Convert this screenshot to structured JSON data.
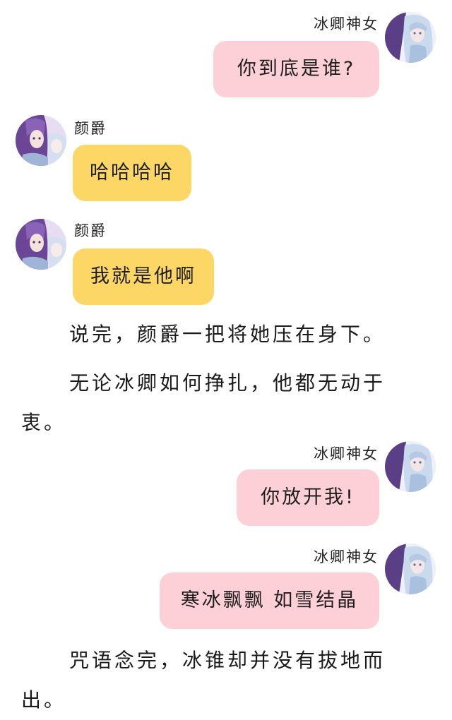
{
  "messages": [
    {
      "sender": "冰卿神女",
      "text": "你到底是谁?"
    },
    {
      "sender": "颜爵",
      "text": "哈哈哈哈"
    },
    {
      "sender": "颜爵",
      "text": "我就是他啊"
    },
    {
      "sender": "冰卿神女",
      "text": "你放开我!"
    },
    {
      "sender": "冰卿神女",
      "text": "寒冰飘飘 如雪结晶"
    }
  ],
  "narration": [
    "说完，颜爵一把将她压在身下。",
    "无论冰卿如何挣扎，他都无动于衷。",
    "咒语念完，冰锥却并没有拔地而出。"
  ],
  "colors": {
    "bubble_pink": "#fcd0d6",
    "bubble_yellow": "#fcd766",
    "text": "#1e1e1e"
  },
  "icons": {
    "female_avatar": "icy-maiden-avatar-icon",
    "male_avatar": "purple-haired-man-avatar-icon"
  }
}
